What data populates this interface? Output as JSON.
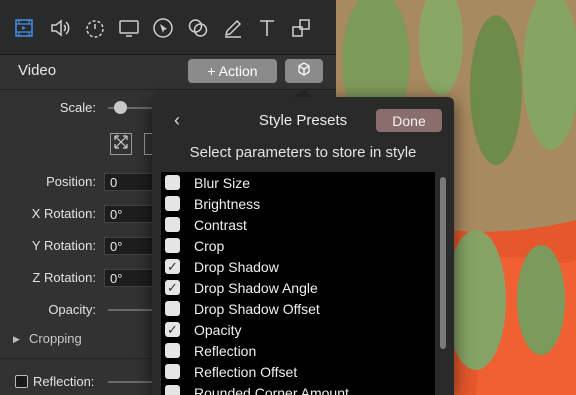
{
  "toolbar": {
    "icons": [
      "film-icon",
      "speaker-icon",
      "timer-icon",
      "display-icon",
      "cursor-icon",
      "overlap-circles-icon",
      "pencil-icon",
      "text-icon",
      "shapes-icon"
    ]
  },
  "header": {
    "title": "Video",
    "action_label": "+ Action"
  },
  "properties": {
    "scale_label": "Scale:",
    "scale_level": 0.1,
    "position_label": "Position:",
    "position_value": "0",
    "x_rotation_label": "X Rotation:",
    "x_rotation_value": "0°",
    "y_rotation_label": "Y Rotation:",
    "y_rotation_value": "0°",
    "z_rotation_label": "Z Rotation:",
    "z_rotation_value": "0°",
    "opacity_label": "Opacity:",
    "cropping_label": "Cropping",
    "reflection_label": "Reflection:"
  },
  "popover": {
    "back": "‹",
    "title": "Style Presets",
    "done_label": "Done",
    "subtitle": "Select parameters to store in style",
    "items": [
      {
        "label": "Blur Size",
        "checked": false
      },
      {
        "label": "Brightness",
        "checked": false
      },
      {
        "label": "Contrast",
        "checked": false
      },
      {
        "label": "Crop",
        "checked": false
      },
      {
        "label": "Drop Shadow",
        "checked": true
      },
      {
        "label": "Drop Shadow Angle",
        "checked": true
      },
      {
        "label": "Drop Shadow Offset",
        "checked": false
      },
      {
        "label": "Opacity",
        "checked": true
      },
      {
        "label": "Reflection",
        "checked": false
      },
      {
        "label": "Reflection Offset",
        "checked": false
      },
      {
        "label": "Rounded Corner Amount",
        "checked": false
      }
    ]
  },
  "colors": {
    "panel": "#323232",
    "button": "#8b8b8b",
    "done": "#8a6e6e",
    "accent": "#3d8be0",
    "photo_orange": "#e85a2e"
  }
}
